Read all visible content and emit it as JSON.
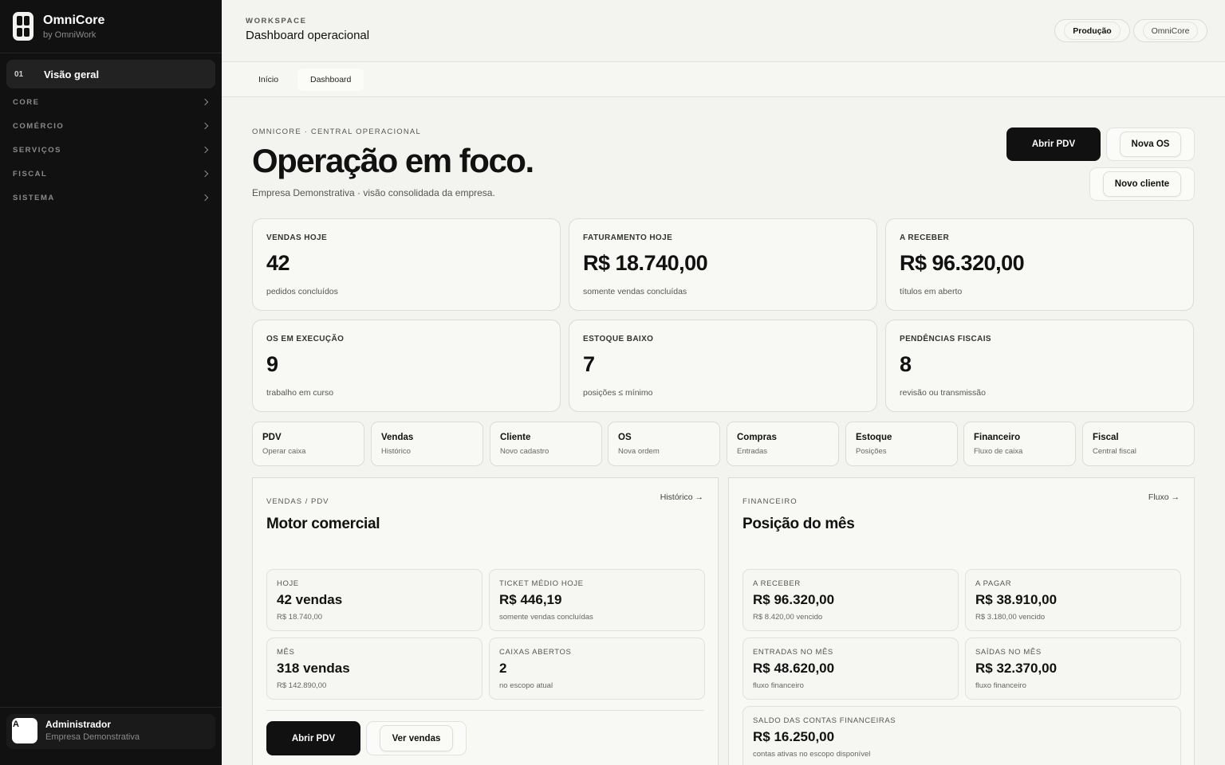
{
  "sidebar": {
    "brand": "OmniCore",
    "brand_sub": "by OmniWork",
    "active": {
      "num": "01",
      "label": "Visão geral"
    },
    "groups": [
      "CORE",
      "COMÉRCIO",
      "SERVIÇOS",
      "FISCAL",
      "SISTEMA"
    ],
    "user": {
      "initial": "A",
      "name": "Administrador",
      "company": "Empresa Demonstrativa"
    }
  },
  "header": {
    "eyebrow": "WORKSPACE",
    "title": "Dashboard operacional",
    "env_pill": "Produção",
    "app_pill": "OmniCore"
  },
  "tabs": [
    "Início",
    "Dashboard"
  ],
  "hero": {
    "eyebrow": "OMNICORE · CENTRAL OPERACIONAL",
    "title": "Operação em foco.",
    "subtitle": "Empresa Demonstrativa · visão consolidada da empresa.",
    "btn_pdv": "Abrir PDV",
    "btn_os": "Nova OS",
    "btn_cliente": "Novo cliente"
  },
  "kpis": [
    {
      "label": "VENDAS HOJE",
      "value": "42",
      "sub": "pedidos concluídos"
    },
    {
      "label": "FATURAMENTO HOJE",
      "value": "R$ 18.740,00",
      "sub": "somente vendas concluídas"
    },
    {
      "label": "A RECEBER",
      "value": "R$ 96.320,00",
      "sub": "títulos em aberto"
    },
    {
      "label": "OS EM EXECUÇÃO",
      "value": "9",
      "sub": "trabalho em curso"
    },
    {
      "label": "ESTOQUE BAIXO",
      "value": "7",
      "sub": "posições ≤ mínimo"
    },
    {
      "label": "PENDÊNCIAS FISCAIS",
      "value": "8",
      "sub": "revisão ou transmissão"
    }
  ],
  "quick": [
    {
      "title": "PDV",
      "sub": "Operar caixa"
    },
    {
      "title": "Vendas",
      "sub": "Histórico"
    },
    {
      "title": "Cliente",
      "sub": "Novo cadastro"
    },
    {
      "title": "OS",
      "sub": "Nova ordem"
    },
    {
      "title": "Compras",
      "sub": "Entradas"
    },
    {
      "title": "Estoque",
      "sub": "Posições"
    },
    {
      "title": "Financeiro",
      "sub": "Fluxo de caixa"
    },
    {
      "title": "Fiscal",
      "sub": "Central fiscal"
    }
  ],
  "vendas": {
    "eyebrow": "VENDAS / PDV",
    "link": "Histórico →",
    "title": "Motor comercial",
    "stats": [
      {
        "label": "HOJE",
        "value": "42 vendas",
        "sub": "R$ 18.740,00"
      },
      {
        "label": "TICKET MÉDIO HOJE",
        "value": "R$ 446,19",
        "sub": "somente vendas concluídas"
      },
      {
        "label": "MÊS",
        "value": "318 vendas",
        "sub": "R$ 142.890,00"
      },
      {
        "label": "CAIXAS ABERTOS",
        "value": "2",
        "sub": "no escopo atual"
      }
    ],
    "btn_pdv": "Abrir PDV",
    "btn_ver": "Ver vendas"
  },
  "financeiro": {
    "eyebrow": "FINANCEIRO",
    "link": "Fluxo →",
    "title": "Posição do mês",
    "stats": [
      {
        "label": "A RECEBER",
        "value": "R$ 96.320,00",
        "sub": "R$ 8.420,00 vencido"
      },
      {
        "label": "A PAGAR",
        "value": "R$ 38.910,00",
        "sub": "R$ 3.180,00 vencido"
      },
      {
        "label": "ENTRADAS NO MÊS",
        "value": "R$ 48.620,00",
        "sub": "fluxo financeiro"
      },
      {
        "label": "SAÍDAS NO MÊS",
        "value": "R$ 32.370,00",
        "sub": "fluxo financeiro"
      },
      {
        "label": "SALDO DAS CONTAS FINANCEIRAS",
        "value": "R$ 16.250,00",
        "sub": "contas ativas no escopo disponível"
      }
    ]
  }
}
